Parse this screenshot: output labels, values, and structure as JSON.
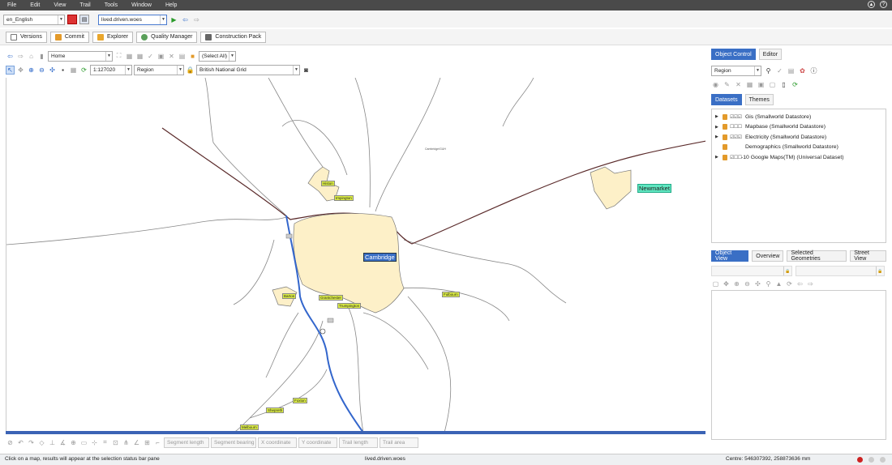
{
  "menu": [
    "File",
    "Edit",
    "View",
    "Trail",
    "Tools",
    "Window",
    "Help"
  ],
  "toolbar_top": {
    "language": "en_English",
    "database": "lived.driven.woes"
  },
  "toolbar_main": {
    "versions": "Versions",
    "commit": "Commit",
    "explorer": "Explorer",
    "quality_manager": "Quality Manager",
    "construction_pack": "Construction Pack"
  },
  "map_toolbar": {
    "home": "Home",
    "select_all": "(Select All)",
    "scale": "1:127020",
    "region": "Region",
    "grid": "British National Grid"
  },
  "map_labels": {
    "cambridge": "Cambridge",
    "newmarket": "Newmarket",
    "histon": "Histon",
    "impington": "Impington",
    "barton": "Barton",
    "grantchester": "Grantchester",
    "trumpington": "Trumpington",
    "fulbourn": "Fulbourn",
    "foxton": "Foxton",
    "shepreth": "Shepreth",
    "melbourn": "Melbourn",
    "small_note": "Cambridge/GUH"
  },
  "bottom_fields": [
    "Segment length",
    "Segment bearing",
    "X coordinate",
    "Y coordinate",
    "Trail length",
    "Trail area"
  ],
  "status": {
    "message": "Click on a map, results will appear at the selection status bar pane",
    "database": "lived.driven.woes",
    "centre": "Centre: 546307392, 258873636 mm"
  },
  "right_panel": {
    "tabs_top": [
      "Object Control",
      "Editor"
    ],
    "region_select": "Region",
    "tabs_mid": [
      "Datasets",
      "Themes"
    ],
    "datasets": [
      {
        "marks": "☑☑☑",
        "name": "Gis (Smallworld Datastore)"
      },
      {
        "marks": "☐☐☐",
        "name": "Mapbase (Smallworld Datastore)"
      },
      {
        "marks": "☑☑☑",
        "name": "Electricity (Smallworld Datastore)"
      },
      {
        "marks": "",
        "name": "Demographics (Smallworld Datastore)"
      },
      {
        "marks": "☑☐☐",
        "name": "-10 Google Maps(TM) (Universal Dataset)"
      }
    ],
    "tabs_bottom": [
      "Object View",
      "Overview",
      "Selected Geometries",
      "Street View"
    ]
  },
  "colors": {
    "accent": "#3a6fc5",
    "town_fill": "#fdf0c8",
    "river": "#3366cc",
    "road": "#5a2a2a"
  }
}
